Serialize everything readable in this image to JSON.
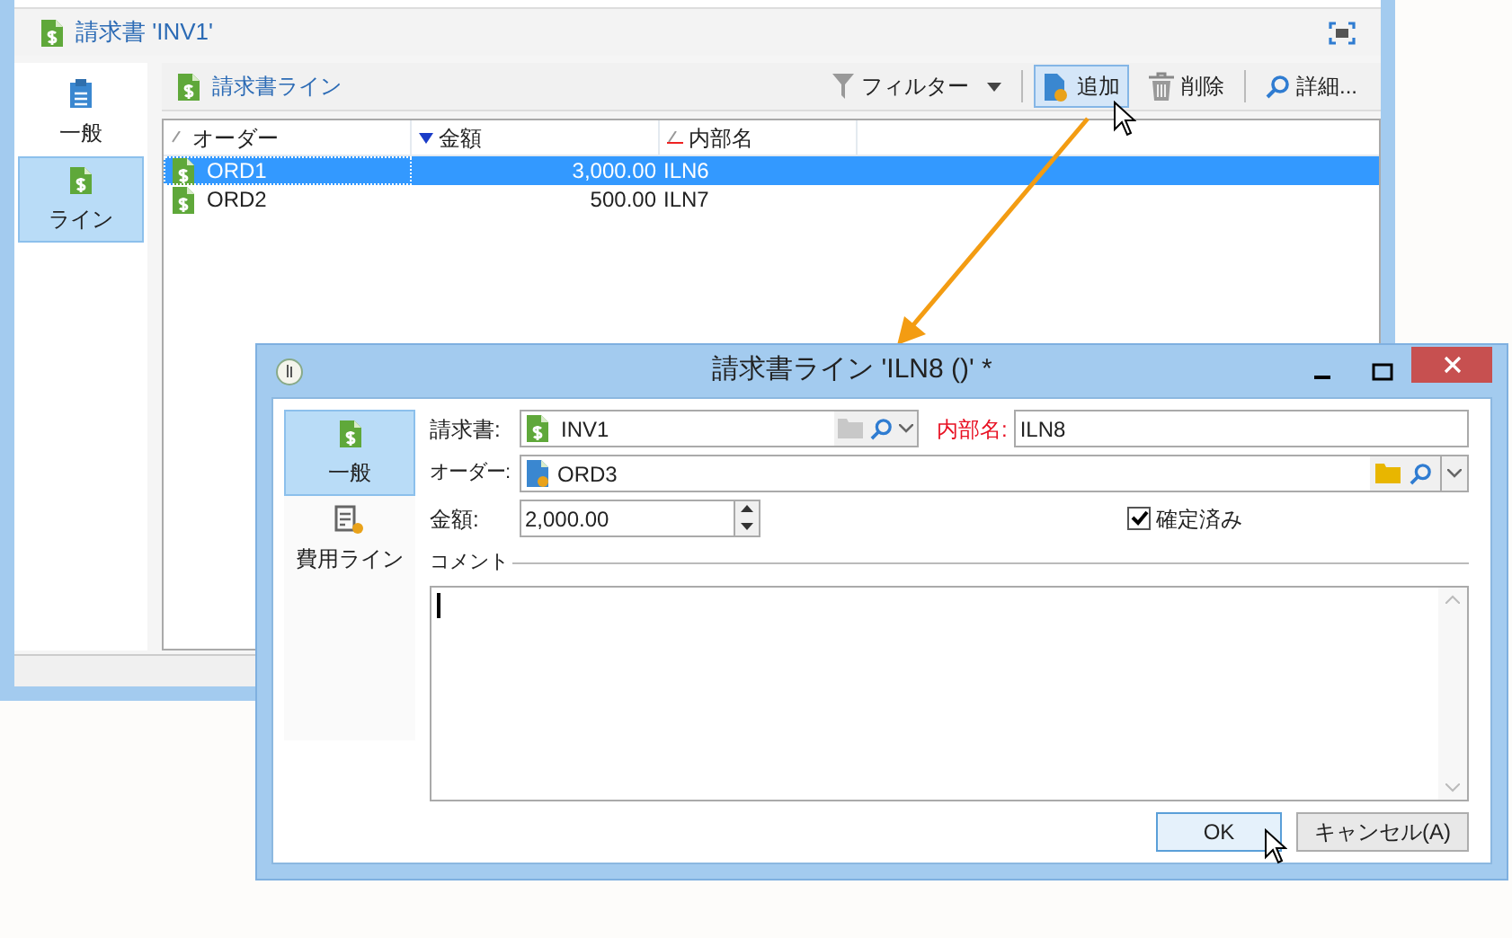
{
  "main_window": {
    "title": "請求書 'INV1'",
    "nav": [
      {
        "label": "一般",
        "kind": "general",
        "selected": false
      },
      {
        "label": "ライン",
        "kind": "lines",
        "selected": true
      }
    ],
    "section_title": "請求書ライン",
    "toolbar": [
      {
        "label": "フィルター",
        "kind": "filter",
        "selected": false
      },
      {
        "label": "追加",
        "kind": "add",
        "selected": true
      },
      {
        "label": "削除",
        "kind": "delete",
        "selected": false
      },
      {
        "label": "詳細...",
        "kind": "detail",
        "selected": false
      }
    ],
    "table": {
      "columns": [
        "オーダー",
        "金額",
        "内部名"
      ],
      "rows": [
        {
          "cells": [
            "ORD1",
            "3,000.00",
            "ILN6"
          ],
          "selected": true
        },
        {
          "cells": [
            "ORD2",
            "500.00",
            "ILN7"
          ],
          "selected": false
        }
      ]
    }
  },
  "dialog": {
    "title": "請求書ライン 'ILN8 ()' *",
    "nav": [
      {
        "label": "一般",
        "kind": "general",
        "selected": true
      },
      {
        "label": "費用ライン",
        "kind": "cost",
        "selected": false
      }
    ],
    "invoice": {
      "label": "請求書:",
      "value": "INV1"
    },
    "internal_name": {
      "label": "内部名:",
      "value": "ILN8",
      "required": true
    },
    "order": {
      "label": "オーダー:",
      "value": "ORD3"
    },
    "amount": {
      "label": "金額:",
      "value": "2,000.00"
    },
    "confirmed": {
      "label": "確定済み",
      "checked": true
    },
    "comment_label": "コメント",
    "buttons": [
      {
        "label": "OK",
        "kind": "ok"
      },
      {
        "label": "キャンセル(A)",
        "kind": "cancel"
      }
    ]
  }
}
